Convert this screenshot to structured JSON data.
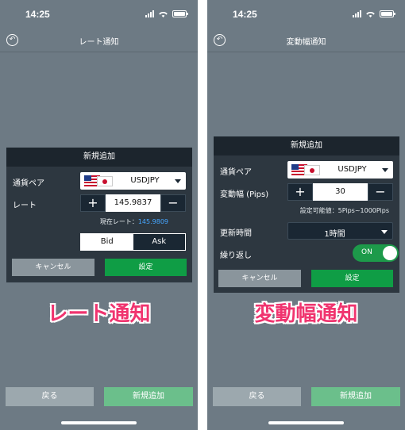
{
  "statusbar": {
    "time": "14:25"
  },
  "left": {
    "nav_title": "レート通知",
    "dialog_title": "新規追加",
    "pair_label": "通貨ペア",
    "pair_value": "USDJPY",
    "rate_label": "レート",
    "rate_value": "145.9837",
    "plus": "+",
    "minus": "−",
    "current_rate_label": "現在レート：",
    "current_rate_value": "145.9809",
    "side_options": [
      "Bid",
      "Ask"
    ],
    "side_selected": "Bid",
    "cancel_label": "キャンセル",
    "set_label": "設定",
    "caption": "レート通知",
    "footer_back": "戻る",
    "footer_add": "新規追加"
  },
  "right": {
    "nav_title": "変動幅通知",
    "dialog_title": "新規追加",
    "pair_label": "通貨ペア",
    "pair_value": "USDJPY",
    "width_label": "変動幅 (Pips)",
    "width_value": "30",
    "plus": "+",
    "minus": "−",
    "range_hint": "設定可能値：5Pips~1000Pips",
    "update_label": "更新時間",
    "update_value": "1時間",
    "repeat_label": "繰り返し",
    "repeat_value": "ON",
    "cancel_label": "キャンセル",
    "set_label": "設定",
    "caption": "変動幅通知",
    "footer_back": "戻る",
    "footer_add": "新規追加"
  },
  "colors": {
    "accent_green": "#0f9d45",
    "link_blue": "#46a6ff",
    "caption_pink": "#f0346f"
  },
  "icons": {
    "back": "back-arrow-icon",
    "dropdown": "chevron-down-icon"
  }
}
